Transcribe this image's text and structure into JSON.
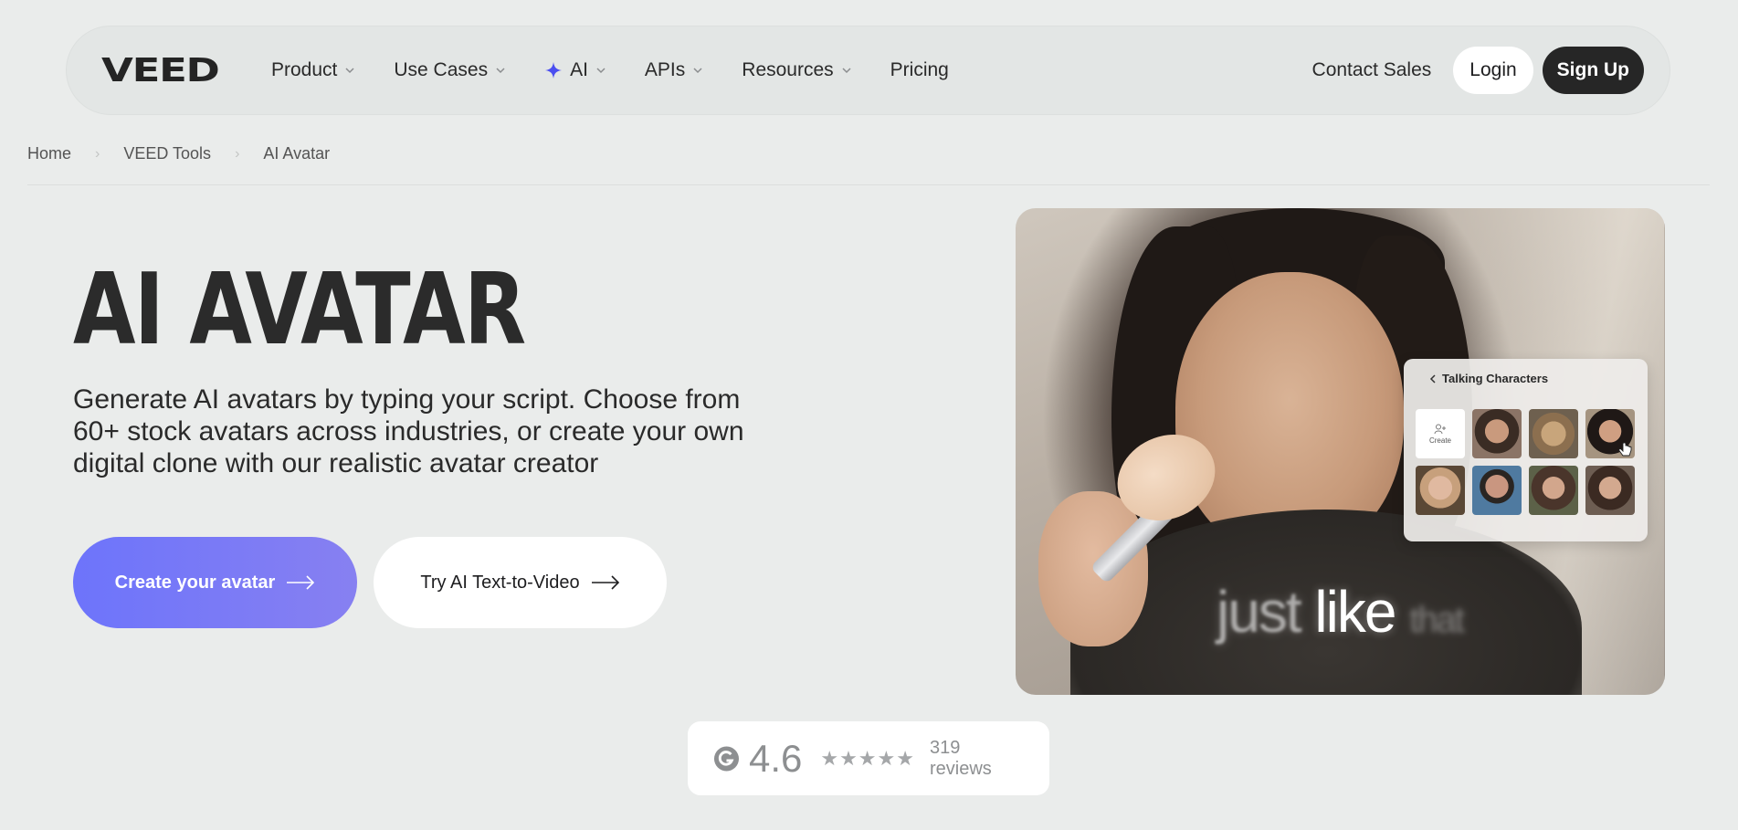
{
  "nav": {
    "logo": "VEED",
    "items": [
      {
        "label": "Product",
        "has_dropdown": true
      },
      {
        "label": "Use Cases",
        "has_dropdown": true
      },
      {
        "label": "AI",
        "has_dropdown": true,
        "icon": "sparkle-icon"
      },
      {
        "label": "APIs",
        "has_dropdown": true
      },
      {
        "label": "Resources",
        "has_dropdown": true
      },
      {
        "label": "Pricing",
        "has_dropdown": false
      }
    ],
    "contact": "Contact Sales",
    "login": "Login",
    "signup": "Sign Up"
  },
  "breadcrumb": [
    "Home",
    "VEED Tools",
    "AI Avatar"
  ],
  "hero": {
    "title": "AI AVATAR",
    "subtitle": "Generate AI avatars by typing your script. Choose from 60+ stock avatars across industries, or create your own digital clone with our realistic avatar creator",
    "primary_cta": "Create your avatar",
    "secondary_cta": "Try AI Text-to-Video"
  },
  "video": {
    "caption_main": "just like",
    "caption_faded_before": "just",
    "caption_faded_after": "that",
    "panel_title": "Talking Characters",
    "create_label": "Create"
  },
  "rating": {
    "score": "4.6",
    "stars": "★★★★★",
    "stars_value": 4.6,
    "reviews": "319 reviews"
  },
  "colors": {
    "background": "#eaeceb",
    "primary_gradient_start": "#6d74fb",
    "primary_gradient_end": "#8780f1",
    "signup_bg": "#262626",
    "sparkle": "#4a4ef0"
  }
}
